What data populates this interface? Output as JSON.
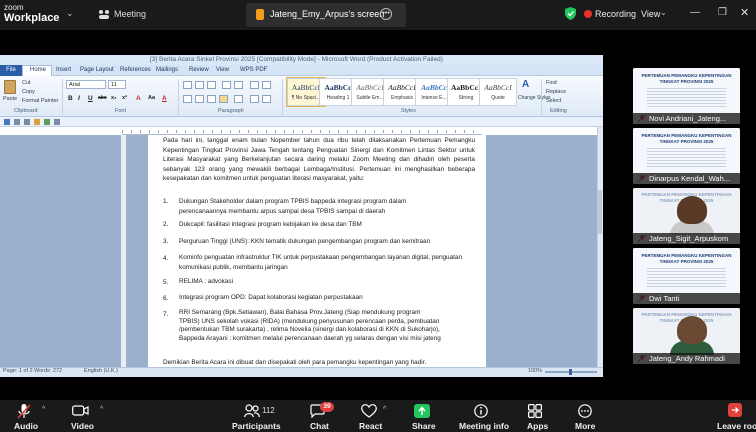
{
  "zoom": {
    "logo_line1": "zoom",
    "logo_line2": "Workplace",
    "meeting_label": "Meeting",
    "share_tab_label": "Jateng_Emy_Arpus's screen",
    "recording_label": "Recording",
    "view_label": "View",
    "colors": {
      "bar": "#1a1a1a",
      "recording": "#e5322d",
      "share_badge": "#f59b1a",
      "share_button": "#23c55e",
      "chat_badge": "#e0413f"
    }
  },
  "word": {
    "title": "[3] Berita Acara Sinkel Provinsi 2025 [Compatibility Mode] - Microsoft Word (Product Activation Failed)",
    "tabs": [
      "File",
      "Home",
      "Insert",
      "Page Layout",
      "References",
      "Mailings",
      "Review",
      "View",
      "WPS PDF"
    ],
    "clipboard": {
      "paste": "Paste",
      "cut": "Cut",
      "copy": "Copy",
      "format_painter": "Format Painter"
    },
    "font_name": "Arial",
    "font_size": "11",
    "format_buttons": [
      "B",
      "I",
      "U",
      "abc",
      "x₂",
      "x²",
      "A",
      "Aa",
      "A"
    ],
    "styles": [
      {
        "sample": "AaBbCcI",
        "name": "¶ No Spaci..."
      },
      {
        "sample": "AaBbCc",
        "name": "Heading 1"
      },
      {
        "sample": "AaBbCcI",
        "name": "Subtle Em..."
      },
      {
        "sample": "AaBbCcI",
        "name": "Emphasis"
      },
      {
        "sample": "AaBbCc",
        "name": "Intense E..."
      },
      {
        "sample": "AaBbCcI",
        "name": "Strong"
      },
      {
        "sample": "AaBbCcI",
        "name": "Quote"
      }
    ],
    "change_styles": "Change Styles",
    "editing": {
      "find": "Find",
      "replace": "Replace",
      "select": "Select"
    },
    "groups": [
      "Clipboard",
      "Font",
      "Paragraph",
      "Styles",
      "Editing"
    ],
    "document": {
      "intro": "Pada hari ini, tanggal enam bulan Nopember tahun dua ribu telah dilaksanakan Pertemuan Pemangku Kepentingan Tingkat Provinsi Jawa Tengah tentang Penguatan Sinergi dan Komitmen Lintas Sektor untuk Literasi Masyarakat yang Berkelanjutan secara daring melalui Zoom Meeting dan dihadiri oleh peserta sebanyak 123 orang yang mewakili berbagai Lembaga/Institusi. Pertemuan ini menghasilkan beberapa kesepakatan dan komitmen untuk penguatan literasi masyarakat, yaitu:",
      "items": [
        {
          "num": "1.",
          "text": "Dukungan Stakeholder dalam program TPBIS bappeda integrasi program dalam perencanaannya membantu arpus sampai desa TPBIS sampai di daerah"
        },
        {
          "num": "2.",
          "text": "Dukcapil: fasilitasi integrasi program kebijakan ke desa dan TBM"
        },
        {
          "num": "3.",
          "text": "Perguruan Tinggi (UNS): KKN tematik dukungan pengembangan program dan kemitraan"
        },
        {
          "num": "4.",
          "text": "Kominfo penguatan infrastruktur TIK untuk perpustakaan pengembangan layanan digital, penguatan komunikasi publik, membantu jaringan"
        },
        {
          "num": "5.",
          "text": "RELIMA : advokasi"
        },
        {
          "num": "6.",
          "text": "Integrasi program OPD: Dapat kolaborasi kegiatan perpustakaan"
        },
        {
          "num": "7.",
          "text": "RRI Semarang (Bpk.Setiawan), Balai Bahasa Prov.Jateng (Siap mendukung program TPBIS) UNS sekolah vokasi (RIDA) (mendukung penyusunan perencaan perda, pembuatan /pembentukan TBM surakarta) , relima Novelia (sinergi dan kolaborasi di KKN di Sukoharjo), Bappeda Arayani : komitmen melalui perencanaan daerah yg selaras dengan visi misi jateng"
        }
      ],
      "closing": "Demikian Berita Acara ini dibuat dan disepakati oleh para pemangku kepentingan yang hadir."
    },
    "status": {
      "page": "Page: 1 of 2",
      "words": "Words: 272",
      "language": "English (U.K.)",
      "zoom": "100%"
    }
  },
  "participants": [
    {
      "name": "Novi Andriani_Jateng...",
      "kind": "slide",
      "muted": true
    },
    {
      "name": "Dinarpus Kendal_Wah...",
      "kind": "slide",
      "muted": true
    },
    {
      "name": "Jateng_Sigit_Arpuskom",
      "kind": "person",
      "muted": true
    },
    {
      "name": "Dwi Tanti",
      "kind": "slide",
      "muted": true
    },
    {
      "name": "Jateng_Andy Rahmadi",
      "kind": "person",
      "muted": true
    }
  ],
  "slide_text": {
    "line1": "PERTEMUAN PEMANGKU KEPENTINGAN",
    "line2": "TINGKAT PROVINSI 2025"
  },
  "toolbar": {
    "audio": "Audio",
    "video": "Video",
    "participants": "Participants",
    "participants_count": "112",
    "chat": "Chat",
    "chat_badge": "39",
    "react": "React",
    "share": "Share",
    "meeting_info": "Meeting info",
    "apps": "Apps",
    "more": "More",
    "leave": "Leave room"
  }
}
